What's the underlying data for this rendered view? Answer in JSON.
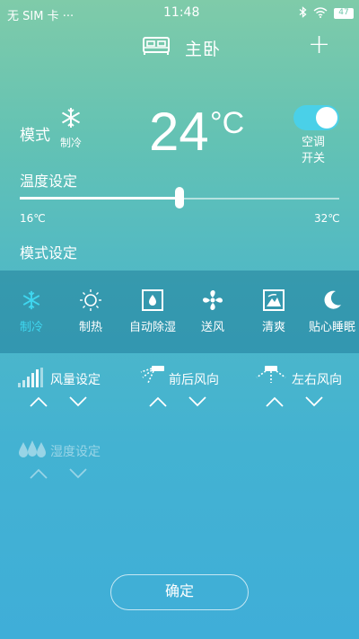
{
  "status_bar": {
    "carrier": "无 SIM 卡 ···",
    "time": "11:48",
    "battery": "47"
  },
  "header": {
    "room": "主卧",
    "add_label": "+"
  },
  "mode": {
    "label": "模式",
    "current": "制冷"
  },
  "temperature": {
    "value": "24",
    "unit": "°C"
  },
  "power": {
    "label_line1": "空调",
    "label_line2": "开关",
    "on": true
  },
  "temp_setting": {
    "title": "温度设定",
    "min": "16℃",
    "max": "32℃",
    "level": 0.5
  },
  "mode_setting": {
    "title": "模式设定"
  },
  "modes": [
    {
      "label": "制冷",
      "icon": "snowflake-icon",
      "active": true
    },
    {
      "label": "制热",
      "icon": "sun-icon",
      "active": false
    },
    {
      "label": "自动除湿",
      "icon": "droplet-icon",
      "active": false
    },
    {
      "label": "送风",
      "icon": "fan-icon",
      "active": false
    },
    {
      "label": "清爽",
      "icon": "fresh-icon",
      "active": false
    },
    {
      "label": "贴心睡眠",
      "icon": "moon-icon",
      "active": false
    }
  ],
  "controls": {
    "fan_speed": "风量设定",
    "front_back": "前后风向",
    "left_right": "左右风向",
    "humidity": "湿度设定"
  },
  "confirm": "确定",
  "colors": {
    "accent": "#3fd7f0",
    "toggle": "#4ad0e8"
  }
}
